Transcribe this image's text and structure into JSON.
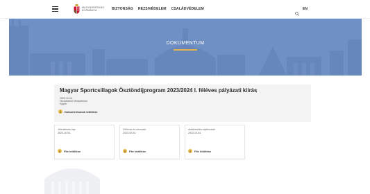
{
  "header": {
    "brand_line1": "Magyarország",
    "brand_line2": "Kormánya",
    "nav": [
      "BIZTONSÁG",
      "REZSIVÉDELEM",
      "CSALÁDVÉDELEM"
    ],
    "lang": "EN"
  },
  "hero": {
    "title": "DOKUMENTUM",
    "accent_color": "#e8b24a",
    "bg_color": "#6f90c4"
  },
  "document": {
    "title": "Magyar Sportcsillagok Ösztöndíjprogram 2023/2024 I. féléves pályázati kiírás",
    "date": "2023.10.04.",
    "ministry": "Honvédelmi Minisztérium",
    "category": "Egyéb",
    "download_label": "Dokumentumok letöltése"
  },
  "files": [
    {
      "label": "Jelentkezési lap",
      "date": "2023.10.04.",
      "download_label": "File letöltése"
    },
    {
      "label": "Felhívás és útmutató",
      "date": "2023.10.04.",
      "download_label": "File letöltése"
    },
    {
      "label": "Adatkezelési tájékoztató",
      "date": "2023.10.04.",
      "download_label": "File letöltése"
    }
  ]
}
